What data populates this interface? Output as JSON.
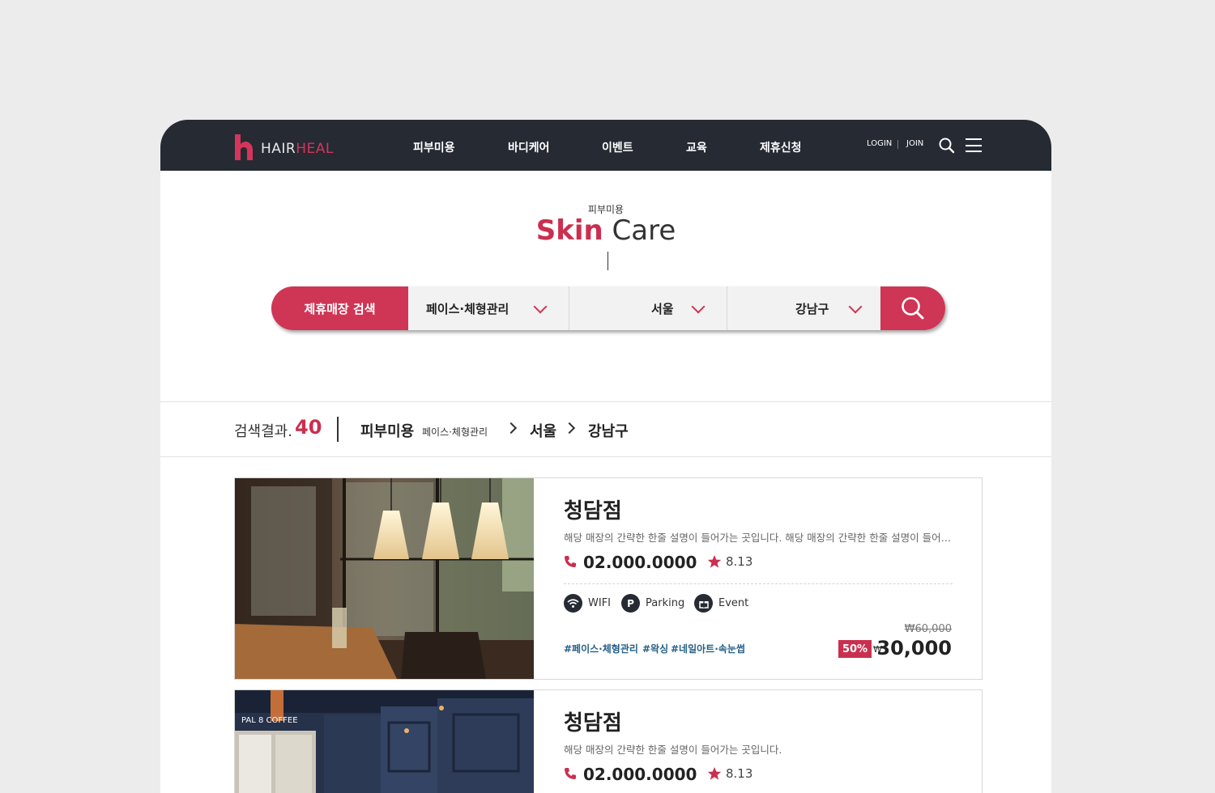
{
  "header": {
    "logo_main": "HAIR",
    "logo_accent": "HEAL",
    "nav": [
      "피부미용",
      "바디케어",
      "이벤트",
      "교육",
      "제휴신청"
    ],
    "login": "LOGIN",
    "join": "JOIN"
  },
  "hero": {
    "subtitle": "피부미용",
    "title_accent": "Skin",
    "title_rest": "Care"
  },
  "search": {
    "label": "제휴매장 검색",
    "category": "페이스·체형관리",
    "city": "서울",
    "district": "강남구"
  },
  "results": {
    "label": "검색결과.",
    "count": "40",
    "crumb_main": "피부미용",
    "crumb_sub": "페이스·체형관리",
    "crumb_city": "서울",
    "crumb_district": "강남구"
  },
  "stores": [
    {
      "name": "청담점",
      "desc": "해당 매장의 간략한 한줄 설명이 들어가는 곳입니다. 해당 매장의 간략한 한줄 설명이 들어가는 곳입니다.",
      "phone": "02.000.0000",
      "rating": "8.13",
      "amenities": [
        "WIFI",
        "Parking",
        "Event"
      ],
      "tags": [
        "#페이스·체형관리",
        "#왁싱",
        "#네일아트·속눈썹"
      ],
      "old_price": "₩60,000",
      "discount": "50%",
      "currency": "₩",
      "price": "30,000"
    },
    {
      "name": "청담점",
      "desc": "해당 매장의 간략한 한줄 설명이 들어가는 곳입니다.",
      "phone": "02.000.0000",
      "rating": "8.13",
      "sign_text": "PAL 8 COFFEE"
    }
  ],
  "colors": {
    "accent": "#cf3555",
    "header_bg": "#262a33"
  }
}
